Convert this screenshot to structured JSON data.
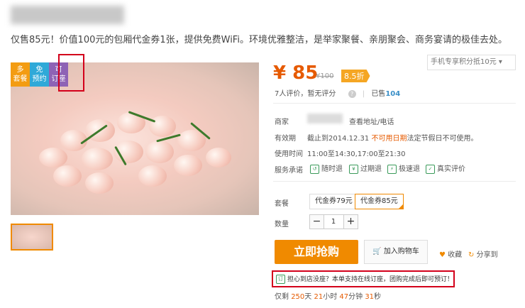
{
  "deal": {
    "description": "仅售85元！价值100元的包厢代金券1张，提供免费WiFi。环境优雅整洁，是举家聚餐、亲朋聚会、商务宴请的极佳去处。",
    "tags": {
      "combo": [
        "多",
        "套餐"
      ],
      "no_reserve": [
        "免",
        "预约"
      ],
      "reserve": [
        "可",
        "订座"
      ]
    }
  },
  "price": {
    "symbol": "¥",
    "current": "85",
    "original": "¥100",
    "discount": "8.5折",
    "app_discount": "手机专享积分抵10元"
  },
  "rating": {
    "reviews": "7人评价，暂无评分",
    "qmark": "?",
    "sold_label": "已售",
    "sold_count": "104"
  },
  "info": {
    "merchant_label": "商家",
    "merchant_link": "查看地址/电话",
    "validity_label": "有效期",
    "validity_value": "截止到2014.12.31",
    "validity_note": "不可用日期",
    "validity_extra": "法定节假日不可使用。",
    "hours_label": "使用时间",
    "hours_value": "11:00至14:30,17:00至21:30",
    "service_label": "服务承诺",
    "services": [
      "随时退",
      "过期退",
      "极速退",
      "真实评价"
    ]
  },
  "package": {
    "label": "套餐",
    "options": [
      "代金券79元",
      "代金券85元"
    ]
  },
  "quantity": {
    "label": "数量",
    "value": "1",
    "minus": "−",
    "plus": "+"
  },
  "actions": {
    "buy": "立即抢购",
    "cart": "加入购物车",
    "favorite": "收藏",
    "share": "分享到"
  },
  "notice": "担心到店没座？本单支持在线订座，团购完成后即可预订！",
  "countdown": {
    "prefix": "仅剩",
    "days": "250",
    "days_unit": "天",
    "hours": "21",
    "hours_unit": "小时",
    "minutes": "47",
    "minutes_unit": "分钟",
    "seconds": "31",
    "seconds_unit": "秒"
  },
  "colors": {
    "accent": "#f08a00",
    "price": "#e65a00",
    "highlight_border": "#d3001b"
  }
}
